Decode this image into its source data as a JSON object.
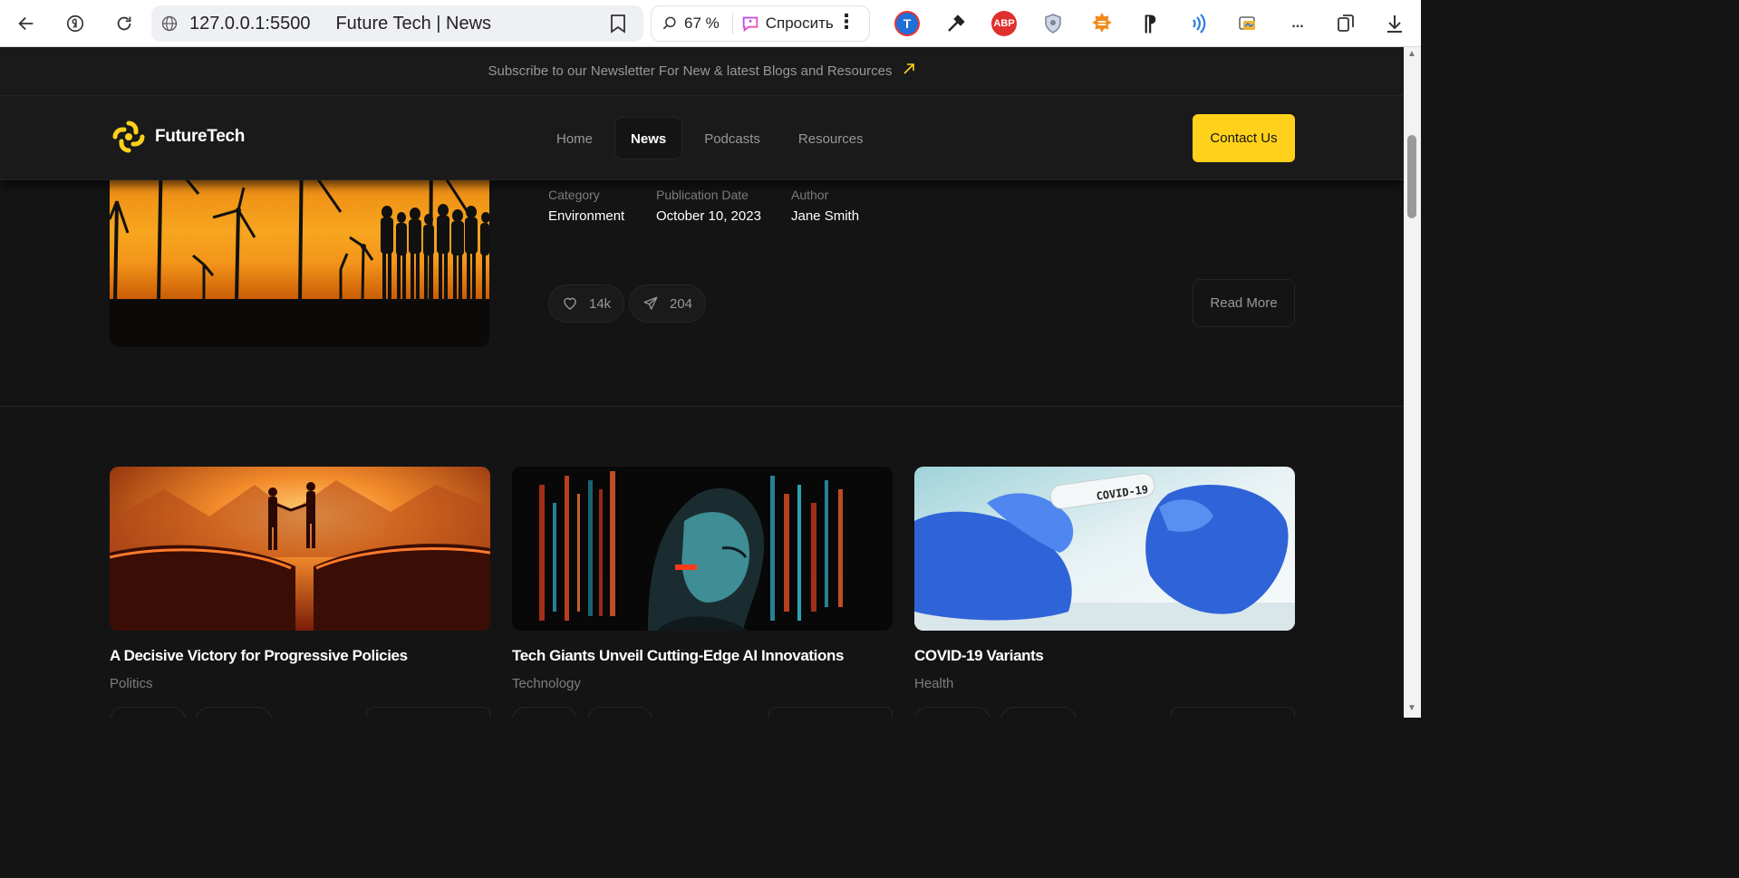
{
  "browser": {
    "url": "127.0.0.1:5500",
    "tab_title": "Future Tech | News",
    "zoom": "67 %",
    "ask_label": "Спросить",
    "overflow_label": "..."
  },
  "newsletter": {
    "text": "Subscribe to our Newsletter For New & latest Blogs and Resources"
  },
  "header": {
    "brand": "FutureTech",
    "menu": [
      {
        "label": "Home"
      },
      {
        "label": "News",
        "active": true
      },
      {
        "label": "Podcasts"
      },
      {
        "label": "Resources"
      }
    ],
    "contact_label": "Contact Us"
  },
  "featured": {
    "meta": [
      {
        "label": "Category",
        "value": "Environment"
      },
      {
        "label": "Publication Date",
        "value": "October 10, 2023"
      },
      {
        "label": "Author",
        "value": "Jane Smith"
      }
    ],
    "likes": "14k",
    "shares": "204",
    "read_more": "Read More"
  },
  "cards": [
    {
      "title": "A Decisive Victory for Progressive Policies",
      "category": "Politics"
    },
    {
      "title": "Tech Giants Unveil Cutting-Edge AI Innovations",
      "category": "Technology"
    },
    {
      "title": "COVID-19 Variants",
      "category": "Health",
      "image_text": "COVID-19"
    }
  ],
  "colors": {
    "accent": "#ffd11a",
    "background": "#141414",
    "surface": "#1a1a1a",
    "muted": "#98989a"
  }
}
